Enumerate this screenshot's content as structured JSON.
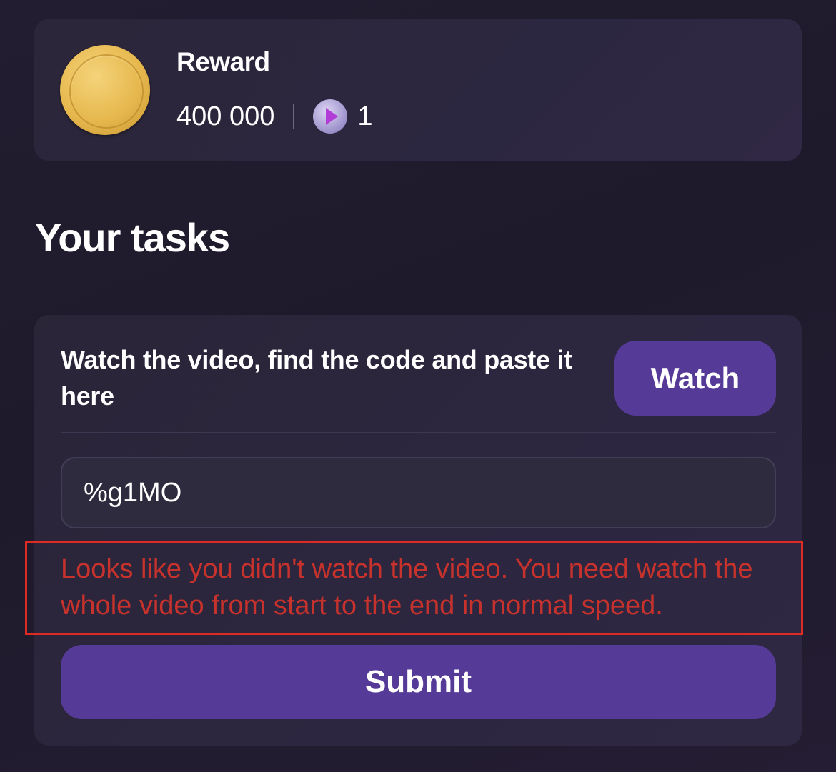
{
  "reward": {
    "title": "Reward",
    "coins": "400 000",
    "videos": "1",
    "coin_icon": "gold-coin-icon",
    "video_icon": "play-icon"
  },
  "tasks": {
    "heading": "Your tasks",
    "instruction": "Watch the video, find the code and paste it here",
    "watch_label": "Watch",
    "code_value": "%g1MO",
    "error_message": "Looks like you didn't watch the video. You need watch the whole video from start to the end in normal speed.",
    "submit_label": "Submit"
  },
  "colors": {
    "accent": "#563a98",
    "error": "#c8322c",
    "highlight_box": "#e02a24"
  }
}
